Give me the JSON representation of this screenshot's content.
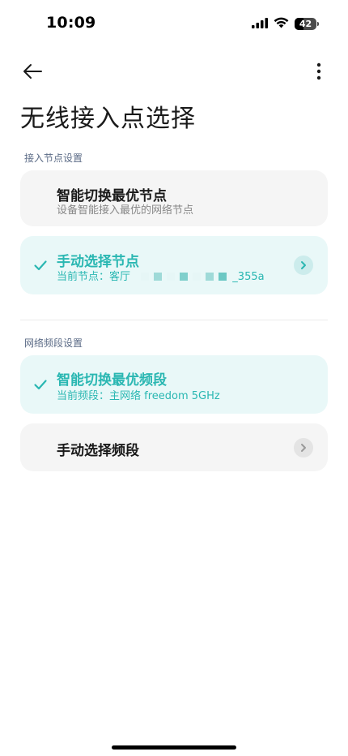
{
  "status_bar": {
    "time": "10:09",
    "battery": "42",
    "battery_level": 0.42
  },
  "header": {
    "title": "无线接入点选择"
  },
  "sections": {
    "node": {
      "label": "接入节点设置",
      "smart": {
        "title": "智能切换最优节点",
        "subtitle": "设备智能接入最优的网络节点"
      },
      "manual": {
        "title": "手动选择节点",
        "subtitle_prefix": "当前节点：客厅",
        "subtitle_suffix": "_355a"
      }
    },
    "band": {
      "label": "网络频段设置",
      "smart": {
        "title": "智能切换最优频段",
        "subtitle": "当前频段：主网络 freedom 5GHz"
      },
      "manual": {
        "title": "手动选择频段"
      }
    }
  },
  "colors": {
    "accent": "#2ab7b2",
    "selected_bg": "#e9f8f8",
    "card_bg": "#f5f5f5",
    "section_label": "#5b6b86"
  },
  "icons": {
    "back": "arrow-left-icon",
    "more": "more-vertical-icon",
    "check": "check-icon",
    "chevron": "chevron-right-icon"
  }
}
